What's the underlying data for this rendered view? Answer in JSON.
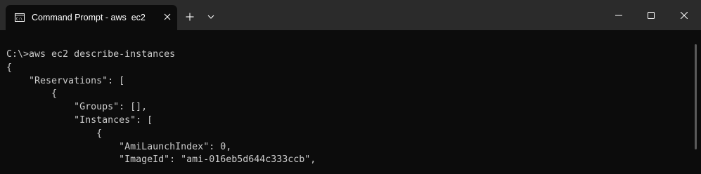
{
  "window": {
    "tab_title": "Command Prompt - aws  ec2",
    "icons": {
      "tab": "command-prompt-icon",
      "tab_close": "close-icon",
      "new_tab": "plus-icon",
      "dropdown": "chevron-down-icon",
      "minimize": "minimize-icon",
      "maximize": "maximize-icon",
      "close": "close-icon"
    }
  },
  "terminal": {
    "lines": [
      "C:\\>aws ec2 describe-instances",
      "{",
      "    \"Reservations\": [",
      "        {",
      "            \"Groups\": [],",
      "            \"Instances\": [",
      "                {",
      "                    \"AmiLaunchIndex\": 0,",
      "                    \"ImageId\": \"ami-016eb5d644c333ccb\","
    ],
    "colors": {
      "background": "#0c0c0c",
      "foreground": "#cccccc",
      "titlebar": "#2b2b2b"
    }
  }
}
